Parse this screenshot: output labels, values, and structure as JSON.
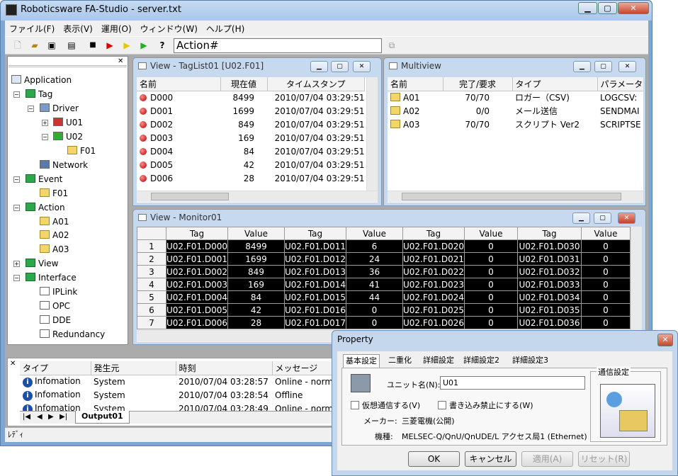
{
  "window": {
    "title": "Roboticsware FA-Studio - server.txt"
  },
  "menu": [
    "ファイル(F)",
    "表示(V)",
    "運用(O)",
    "ウィンドウ(W)",
    "ヘルプ(H)"
  ],
  "toolbar": {
    "action_value": "Action#"
  },
  "tree": {
    "items": [
      {
        "label": "Application",
        "icon": "app-icon"
      },
      {
        "label": "Tag",
        "icon": "tag-icon"
      },
      {
        "label": "Driver",
        "icon": "driver-icon"
      },
      {
        "label": "U01",
        "icon": "unit-icon"
      },
      {
        "label": "U02",
        "icon": "unit-icon"
      },
      {
        "label": "F01",
        "icon": "folder-icon"
      },
      {
        "label": "Network",
        "icon": "network-icon"
      },
      {
        "label": "Event",
        "icon": "event-icon"
      },
      {
        "label": "F01",
        "icon": "folder-icon"
      },
      {
        "label": "Action",
        "icon": "action-icon"
      },
      {
        "label": "A01",
        "icon": "folder-icon"
      },
      {
        "label": "A02",
        "icon": "folder-icon"
      },
      {
        "label": "A03",
        "icon": "folder-icon"
      },
      {
        "label": "View",
        "icon": "view-icon"
      },
      {
        "label": "Interface",
        "icon": "interface-icon"
      },
      {
        "label": "IPLink",
        "icon": "doc-icon"
      },
      {
        "label": "OPC",
        "icon": "doc-icon"
      },
      {
        "label": "DDE",
        "icon": "doc-icon"
      },
      {
        "label": "Redundancy",
        "icon": "doc-icon"
      }
    ]
  },
  "taglist": {
    "title": "View - TagList01 [U02.F01]",
    "headers": [
      "名前",
      "現在値",
      "タイムスタンプ"
    ],
    "rows": [
      [
        "D000",
        "8499",
        "2010/07/04 03:29:51"
      ],
      [
        "D001",
        "1699",
        "2010/07/04 03:29:51"
      ],
      [
        "D002",
        "849",
        "2010/07/04 03:29:51"
      ],
      [
        "D003",
        "169",
        "2010/07/04 03:29:51"
      ],
      [
        "D004",
        "84",
        "2010/07/04 03:29:51"
      ],
      [
        "D005",
        "42",
        "2010/07/04 03:29:51"
      ],
      [
        "D006",
        "28",
        "2010/07/04 03:29:51"
      ]
    ]
  },
  "multiview": {
    "title": "Multiview",
    "headers": [
      "名前",
      "完了/要求",
      "タイプ",
      "パラメータ"
    ],
    "rows": [
      [
        "A01",
        "70/70",
        "ロガー（CSV)",
        "LOGCSV:"
      ],
      [
        "A02",
        "0/0",
        "メール送信",
        "SENDMAI"
      ],
      [
        "A03",
        "70/70",
        "スクリプト Ver2",
        "SCRIPTSE"
      ]
    ]
  },
  "monitor": {
    "title": "View - Monitor01",
    "headers": [
      "Tag",
      "Value",
      "Tag",
      "Value",
      "Tag",
      "Value",
      "Tag",
      "Value"
    ],
    "rows": [
      [
        "1",
        "U02.F01.D000",
        "8499",
        "U02.F01.D011",
        "6",
        "U02.F01.D020",
        "0",
        "U02.F01.D030",
        "0"
      ],
      [
        "2",
        "U02.F01.D001",
        "1699",
        "U02.F01.D012",
        "24",
        "U02.F01.D021",
        "0",
        "U02.F01.D031",
        "0"
      ],
      [
        "3",
        "U02.F01.D002",
        "849",
        "U02.F01.D013",
        "36",
        "U02.F01.D022",
        "0",
        "U02.F01.D032",
        "0"
      ],
      [
        "4",
        "U02.F01.D003",
        "169",
        "U02.F01.D014",
        "41",
        "U02.F01.D023",
        "0",
        "U02.F01.D033",
        "0"
      ],
      [
        "5",
        "U02.F01.D004",
        "84",
        "U02.F01.D015",
        "44",
        "U02.F01.D024",
        "0",
        "U02.F01.D034",
        "0"
      ],
      [
        "6",
        "U02.F01.D005",
        "42",
        "U02.F01.D016",
        "0",
        "U02.F01.D025",
        "0",
        "U02.F01.D035",
        "0"
      ],
      [
        "7",
        "U02.F01.D006",
        "28",
        "U02.F01.D017",
        "0",
        "U02.F01.D026",
        "0",
        "U02.F01.D036",
        "0"
      ]
    ]
  },
  "output": {
    "headers": [
      "タイプ",
      "発生元",
      "時刻",
      "メッセージ"
    ],
    "rows": [
      [
        "Infomation",
        "System",
        "2010/07/04 03:28:57",
        "Online - norm"
      ],
      [
        "Infomation",
        "System",
        "2010/07/04 03:28:54",
        "Offline"
      ],
      [
        "Infomation",
        "System",
        "2010/07/04 03:28:49",
        "Online - norm"
      ]
    ],
    "tab": "Output01"
  },
  "status": {
    "text": "ﾚﾃﾞｨ"
  },
  "property": {
    "title": "Property",
    "tabs": [
      "基本設定",
      "二重化",
      "詳細設定",
      "詳細設定2",
      "詳細設定3"
    ],
    "unit_label": "ユニット名(N):",
    "unit_value": "U01",
    "comm_label": "通信設定",
    "virtual_label": "仮想通信する(V)",
    "writeprotect_label": "書き込み禁止にする(W)",
    "maker_label": "メーカー:",
    "maker_value": "三菱電機(公開)",
    "model_label": "機種:",
    "model_value": "MELSEC-Q/QnU/QnUDE/L アクセス局1 (Ethernet)",
    "buttons": [
      "OK",
      "キャンセル",
      "適用(A)",
      "リセット(R)"
    ]
  }
}
